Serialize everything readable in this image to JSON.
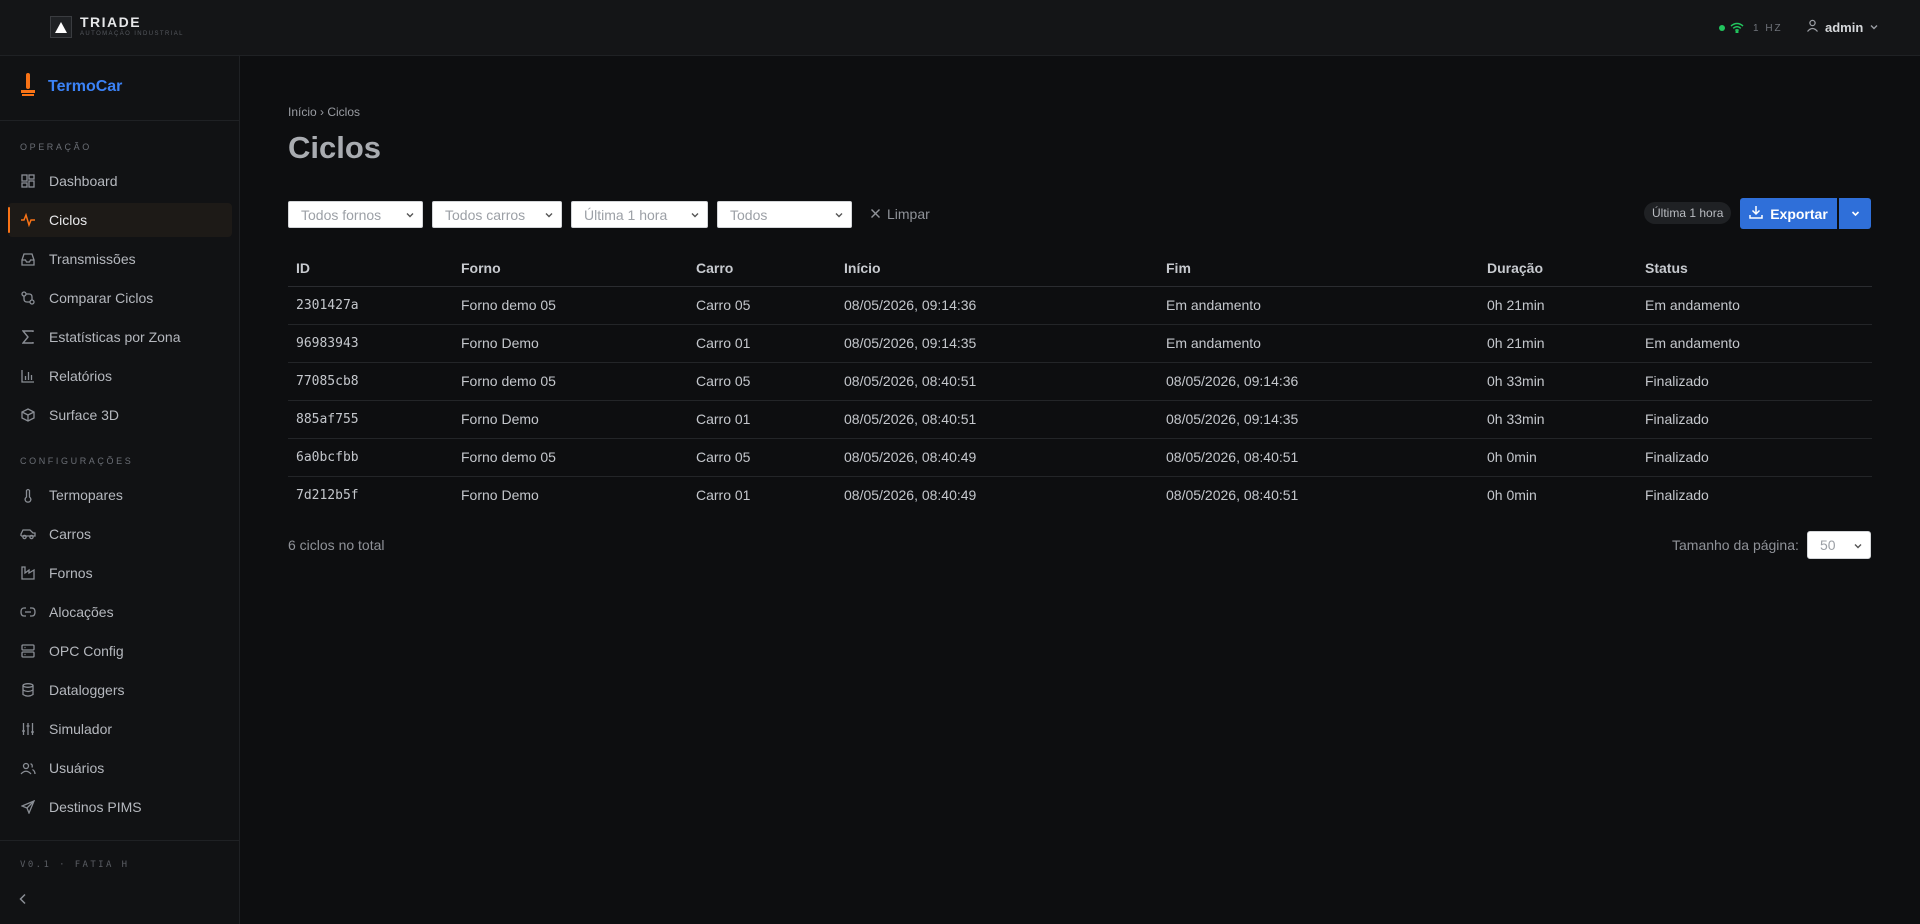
{
  "header": {
    "brand_name": "TRIADE",
    "brand_tagline": "AUTOMAÇÃO INDUSTRIAL",
    "connection_rate": "1 HZ",
    "user_name": "admin",
    "status_color": "#22c55e"
  },
  "sidebar": {
    "app_name": "TermoCar",
    "sections": [
      {
        "title": "OPERAÇÃO",
        "items": [
          {
            "label": "Dashboard",
            "icon": "grid-icon"
          },
          {
            "label": "Ciclos",
            "icon": "activity-icon",
            "active": true
          },
          {
            "label": "Transmissões",
            "icon": "inbox-icon"
          },
          {
            "label": "Comparar Ciclos",
            "icon": "git-compare-icon"
          },
          {
            "label": "Estatísticas por Zona",
            "icon": "sigma-icon"
          },
          {
            "label": "Relatórios",
            "icon": "bar-chart-icon"
          },
          {
            "label": "Surface 3D",
            "icon": "cube-icon"
          }
        ]
      },
      {
        "title": "CONFIGURAÇÕES",
        "items": [
          {
            "label": "Termopares",
            "icon": "thermometer-icon"
          },
          {
            "label": "Carros",
            "icon": "car-icon"
          },
          {
            "label": "Fornos",
            "icon": "factory-icon"
          },
          {
            "label": "Alocações",
            "icon": "link-icon"
          },
          {
            "label": "OPC Config",
            "icon": "server-icon"
          },
          {
            "label": "Dataloggers",
            "icon": "database-icon"
          },
          {
            "label": "Simulador",
            "icon": "sliders-icon"
          },
          {
            "label": "Usuários",
            "icon": "users-icon"
          },
          {
            "label": "Destinos PIMS",
            "icon": "send-icon"
          }
        ]
      }
    ],
    "version": "V0.1 · FATIA H",
    "accent_color": "#f97316"
  },
  "breadcrumb": "Início › Ciclos",
  "page_title": "Ciclos",
  "filters": {
    "furnace_placeholder": "Todos fornos",
    "car_placeholder": "Todos carros",
    "period_placeholder": "Última 1 hora",
    "status_placeholder": "Todos",
    "clear_label": "Limpar",
    "range_badge": "Última 1 hora",
    "export_label": "Exportar"
  },
  "table": {
    "columns": [
      "ID",
      "Forno",
      "Carro",
      "Início",
      "Fim",
      "Duração",
      "Status"
    ],
    "rows": [
      [
        "2301427a",
        "Forno demo 05",
        "Carro 05",
        "08/05/2026, 09:14:36",
        "Em andamento",
        "0h 21min",
        "Em andamento"
      ],
      [
        "96983943",
        "Forno Demo",
        "Carro 01",
        "08/05/2026, 09:14:35",
        "Em andamento",
        "0h 21min",
        "Em andamento"
      ],
      [
        "77085cb8",
        "Forno demo 05",
        "Carro 05",
        "08/05/2026, 08:40:51",
        "08/05/2026, 09:14:36",
        "0h 33min",
        "Finalizado"
      ],
      [
        "885af755",
        "Forno Demo",
        "Carro 01",
        "08/05/2026, 08:40:51",
        "08/05/2026, 09:14:35",
        "0h 33min",
        "Finalizado"
      ],
      [
        "6a0bcfbb",
        "Forno demo 05",
        "Carro 05",
        "08/05/2026, 08:40:49",
        "08/05/2026, 08:40:51",
        "0h 0min",
        "Finalizado"
      ],
      [
        "7d212b5f",
        "Forno Demo",
        "Carro 01",
        "08/05/2026, 08:40:49",
        "08/05/2026, 08:40:51",
        "0h 0min",
        "Finalizado"
      ]
    ]
  },
  "footer": {
    "total_label": "6 ciclos no total",
    "page_size_label": "Tamanho da página:",
    "page_size_value": "50"
  }
}
